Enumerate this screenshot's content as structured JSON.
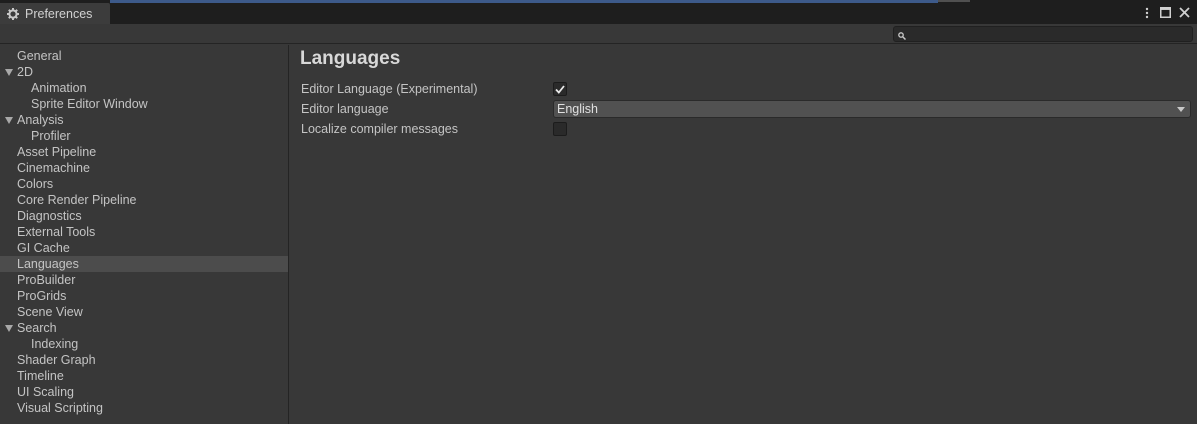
{
  "window": {
    "tab_title": "Preferences",
    "tab_icon": "gear-icon"
  },
  "search": {
    "placeholder": ""
  },
  "sidebar": {
    "items": [
      {
        "label": "General",
        "level": 0,
        "expandable": false
      },
      {
        "label": "2D",
        "level": 0,
        "expandable": true
      },
      {
        "label": "Animation",
        "level": 1,
        "expandable": false
      },
      {
        "label": "Sprite Editor Window",
        "level": 1,
        "expandable": false
      },
      {
        "label": "Analysis",
        "level": 0,
        "expandable": true
      },
      {
        "label": "Profiler",
        "level": 1,
        "expandable": false
      },
      {
        "label": "Asset Pipeline",
        "level": 0,
        "expandable": false
      },
      {
        "label": "Cinemachine",
        "level": 0,
        "expandable": false
      },
      {
        "label": "Colors",
        "level": 0,
        "expandable": false
      },
      {
        "label": "Core Render Pipeline",
        "level": 0,
        "expandable": false
      },
      {
        "label": "Diagnostics",
        "level": 0,
        "expandable": false
      },
      {
        "label": "External Tools",
        "level": 0,
        "expandable": false
      },
      {
        "label": "GI Cache",
        "level": 0,
        "expandable": false
      },
      {
        "label": "Languages",
        "level": 0,
        "expandable": false,
        "selected": true
      },
      {
        "label": "ProBuilder",
        "level": 0,
        "expandable": false
      },
      {
        "label": "ProGrids",
        "level": 0,
        "expandable": false
      },
      {
        "label": "Scene View",
        "level": 0,
        "expandable": false
      },
      {
        "label": "Search",
        "level": 0,
        "expandable": true
      },
      {
        "label": "Indexing",
        "level": 1,
        "expandable": false
      },
      {
        "label": "Shader Graph",
        "level": 0,
        "expandable": false
      },
      {
        "label": "Timeline",
        "level": 0,
        "expandable": false
      },
      {
        "label": "UI Scaling",
        "level": 0,
        "expandable": false
      },
      {
        "label": "Visual Scripting",
        "level": 0,
        "expandable": false
      }
    ]
  },
  "main": {
    "title": "Languages",
    "editor_language_experimental": {
      "label": "Editor Language (Experimental)",
      "checked": true
    },
    "editor_language": {
      "label": "Editor language",
      "value": "English"
    },
    "localize_compiler_messages": {
      "label": "Localize compiler messages",
      "checked": false
    }
  },
  "colors": {
    "background": "#383838",
    "selected_row": "#4c4c4c",
    "title_bar": "#1e1e1e"
  }
}
